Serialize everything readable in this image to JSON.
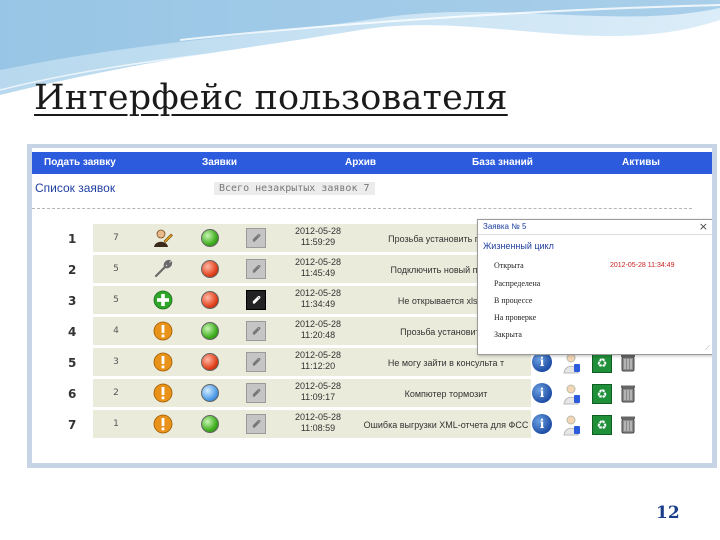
{
  "slide": {
    "title": "Интерфейс пользователя",
    "page_number": "12"
  },
  "nav": {
    "items": [
      "Подать заявку",
      "Заявки",
      "Архив",
      "База знаний",
      "Активы"
    ]
  },
  "toolbar": {
    "list_title": "Список заявок",
    "open_count_label": "Всего незакрытых заявок 7"
  },
  "tickets": [
    {
      "num": "1",
      "priority": "7",
      "type_icon": "user-edit-icon",
      "status": "green",
      "attachment": "light",
      "date": "2012-05-28",
      "time": "11:59:29",
      "subject": "Прозьба установить пишущ"
    },
    {
      "num": "2",
      "priority": "5",
      "type_icon": "wrench-icon",
      "status": "red",
      "attachment": "light",
      "date": "2012-05-28",
      "time": "11:45:49",
      "subject": "Подключить новый принте"
    },
    {
      "num": "3",
      "priority": "5",
      "type_icon": "plus-icon",
      "status": "red",
      "attachment": "dark",
      "date": "2012-05-28",
      "time": "11:34:49",
      "subject": "Не открывается xls док"
    },
    {
      "num": "4",
      "priority": "4",
      "type_icon": "warning-icon",
      "status": "green",
      "attachment": "light",
      "date": "2012-05-28",
      "time": "11:20:48",
      "subject": "Прозьба установить L"
    },
    {
      "num": "5",
      "priority": "3",
      "type_icon": "warning-icon",
      "status": "red",
      "attachment": "light",
      "date": "2012-05-28",
      "time": "11:12:20",
      "subject": "Не могу зайти в консульта т"
    },
    {
      "num": "6",
      "priority": "2",
      "type_icon": "warning-icon",
      "status": "blue",
      "attachment": "light",
      "date": "2012-05-28",
      "time": "11:09:17",
      "subject": "Компютер тормозит"
    },
    {
      "num": "7",
      "priority": "1",
      "type_icon": "warning-icon",
      "status": "green",
      "attachment": "light",
      "date": "2012-05-28",
      "time": "11:08:59",
      "subject": "Ошибка выгрузки XML-отчета для ФСС"
    }
  ],
  "popup": {
    "title": "Заявка № 5",
    "section": "Жизненный цикл",
    "stages": [
      "Открыта",
      "Распределена",
      "В процессе",
      "На проверке",
      "Закрыта"
    ],
    "opened_at": "2012-05-28 11:34:49",
    "close_label": "×"
  },
  "colors": {
    "nav_bg": "#2c5bde",
    "row_bg": "#ebebdc",
    "frame": "#c7d4e6",
    "accent_red": "#cc2222"
  }
}
